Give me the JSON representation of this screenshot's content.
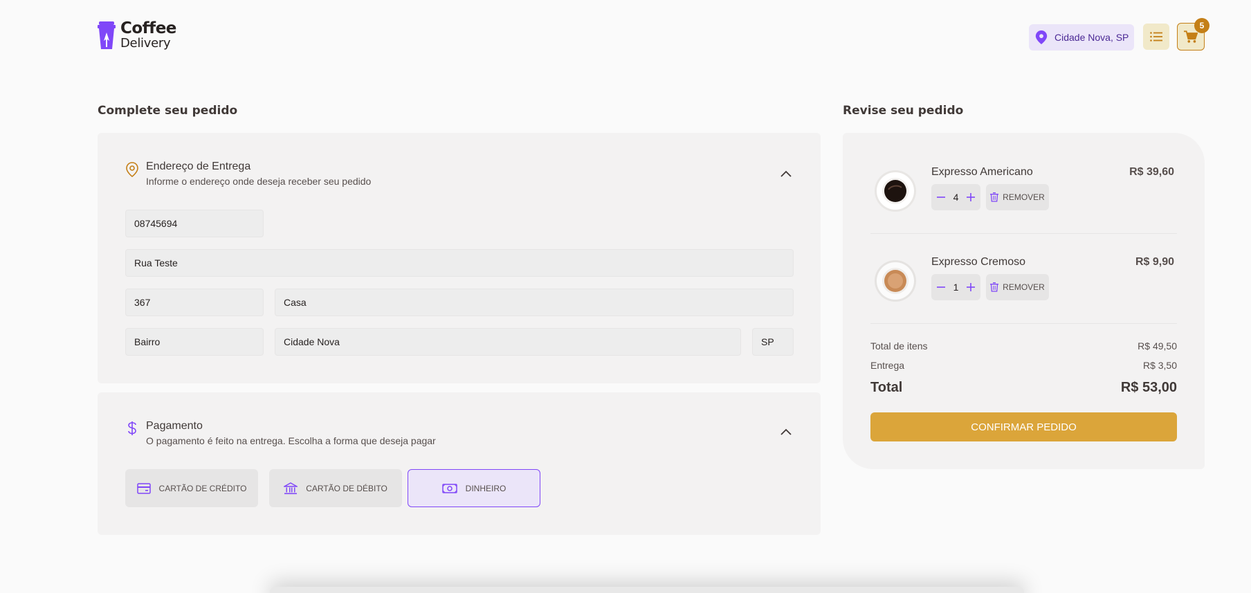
{
  "header": {
    "logo_line1": "Coffee",
    "logo_line2": "Delivery",
    "location": "Cidade Nova, SP",
    "cart_count": "5"
  },
  "checkout": {
    "title": "Complete seu pedido",
    "address": {
      "title": "Endereço de Entrega",
      "subtitle": "Informe o endereço onde deseja receber seu pedido",
      "fields": {
        "cep": "08745694",
        "street": "Rua Teste",
        "number": "367",
        "complement": "Casa",
        "district": "Bairro",
        "city": "Cidade Nova",
        "uf": "SP"
      }
    },
    "payment": {
      "title": "Pagamento",
      "subtitle": "O pagamento é feito na entrega. Escolha a forma que deseja pagar",
      "options": [
        {
          "label": "CARTÃO DE CRÉDITO",
          "icon": "credit-card-icon",
          "selected": false
        },
        {
          "label": "CARTÃO DE DÉBITO",
          "icon": "bank-icon",
          "selected": false
        },
        {
          "label": "DINHEIRO",
          "icon": "money-icon",
          "selected": true
        }
      ]
    }
  },
  "order": {
    "title": "Revise seu pedido",
    "items": [
      {
        "name": "Expresso Americano",
        "price": "R$ 39,60",
        "qty": "4",
        "remove_label": "REMOVER"
      },
      {
        "name": "Expresso Cremoso",
        "price": "R$ 9,90",
        "qty": "1",
        "remove_label": "REMOVER"
      }
    ],
    "totals": {
      "items_label": "Total de itens",
      "items_value": "R$ 49,50",
      "delivery_label": "Entrega",
      "delivery_value": "R$ 3,50",
      "total_label": "Total",
      "total_value": "R$ 53,00"
    },
    "confirm_label": "CONFIRMAR PEDIDO"
  },
  "colors": {
    "purple": "#8047f8",
    "purple_dark": "#4b2995",
    "yellow": "#dba53a",
    "yellow_dark": "#c47f17"
  }
}
